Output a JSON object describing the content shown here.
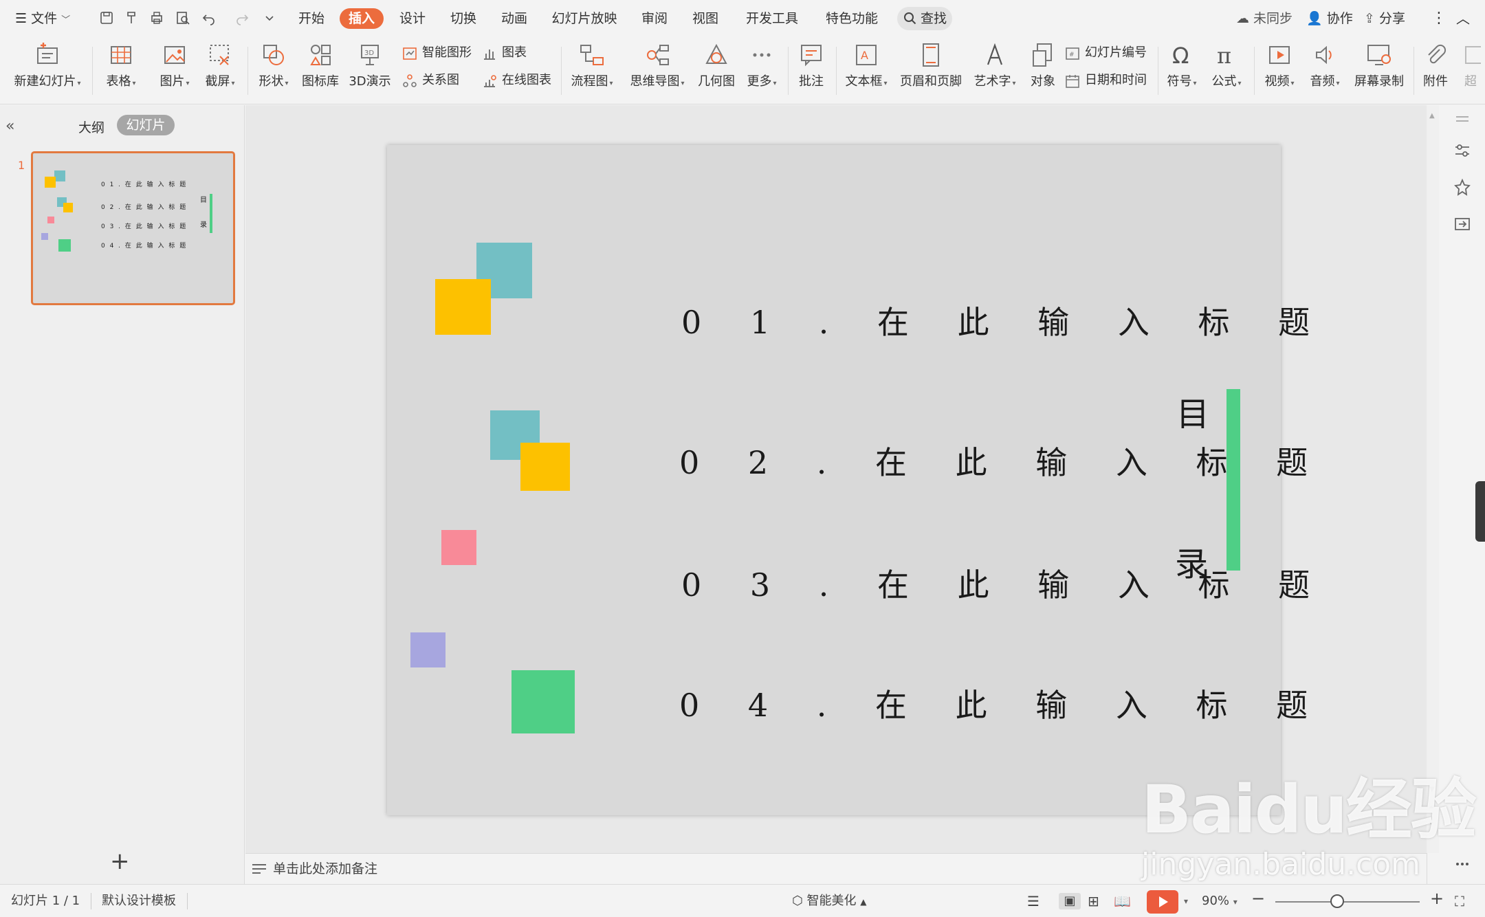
{
  "menubar": {
    "file_label": "文件",
    "tabs": [
      "开始",
      "插入",
      "设计",
      "切换",
      "动画",
      "幻灯片放映",
      "审阅",
      "视图",
      "开发工具",
      "特色功能"
    ],
    "active_tab": "插入",
    "search_label": "查找",
    "sync_label": "未同步",
    "collab_label": "协作",
    "share_label": "分享"
  },
  "ribbon": {
    "new_slide": "新建幻灯片",
    "table": "表格",
    "picture": "图片",
    "screenshot": "截屏",
    "shape": "形状",
    "icon_lib": "图标库",
    "demo3d": "3D演示",
    "smart_graphic": "智能图形",
    "chart": "图表",
    "relation": "关系图",
    "online_chart": "在线图表",
    "flowchart": "流程图",
    "mindmap": "思维导图",
    "geometry": "几何图",
    "more": "更多",
    "comment": "批注",
    "textbox": "文本框",
    "header_footer": "页眉和页脚",
    "wordart": "艺术字",
    "object": "对象",
    "slide_number": "幻灯片编号",
    "datetime": "日期和时间",
    "symbol": "符号",
    "formula": "公式",
    "video": "视频",
    "audio": "音频",
    "screen_record": "屏幕录制",
    "attachment": "附件",
    "overflow": "超"
  },
  "left_panel": {
    "outline_tab": "大纲",
    "slides_tab": "幻灯片",
    "slide_index": "1"
  },
  "slide": {
    "items": [
      "0 1 . 在 此 输 入 标 题",
      "0 2 . 在 此 输 入 标 题",
      "0 3 . 在 此 输 入 标 题",
      "0 4 . 在 此 输 入 标 题"
    ],
    "mulu_top": "目",
    "mulu_bottom": "录",
    "colors": {
      "teal": "#73bfc4",
      "yellow": "#fdc100",
      "pink": "#f88a98",
      "purple": "#a7a6df",
      "green": "#4fcf86",
      "slide_bg": "#d9d9d9"
    }
  },
  "thumbnail": {
    "items": [
      "0 1 . 在 此 输 入 标 题",
      "0 2 . 在 此 输 入 标 题",
      "0 3 . 在 此 输 入 标 题",
      "0 4 . 在 此 输 入 标 题"
    ],
    "mulu_top": "目",
    "mulu_bottom": "录"
  },
  "notes": {
    "placeholder": "单击此处添加备注"
  },
  "statusbar": {
    "slide_info": "幻灯片 1 / 1",
    "template": "默认设计模板",
    "beautify": "智能美化",
    "zoom": "90%"
  },
  "watermark": {
    "logo": "Baidu经验",
    "url": "jingyan.baidu.com"
  }
}
